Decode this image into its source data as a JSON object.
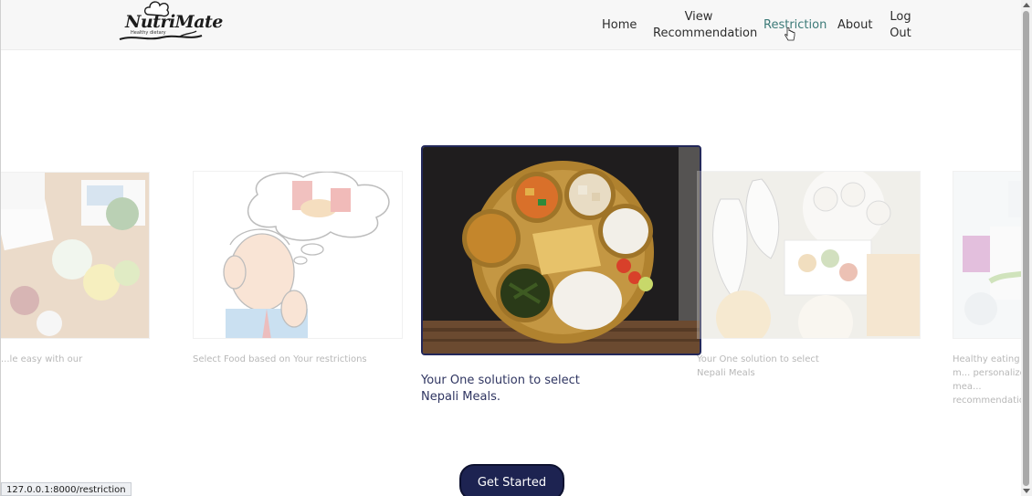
{
  "logo": {
    "text": "NutriMate",
    "subtitle": "Healthy dietary"
  },
  "nav": {
    "home": "Home",
    "view_recommendation_line1": "View",
    "view_recommendation_line2": "Recommendation",
    "restriction": "Restriction",
    "about": "About",
    "logout_line1": "Log",
    "logout_line2": "Out"
  },
  "carousel": {
    "slides": [
      {
        "caption": "...le easy with our"
      },
      {
        "caption": "Select Food based on Your restrictions"
      },
      {
        "caption": "Your One solution to select Nepali Meals."
      },
      {
        "caption": "Your One solution to select Nepali Meals"
      },
      {
        "caption": "Healthy eating m... personalized mea... recommendation..."
      }
    ],
    "active_index": 2
  },
  "cta": {
    "label": "Get Started"
  },
  "status": {
    "url": "127.0.0.1:8000/restriction"
  },
  "colors": {
    "accent": "#1d2351",
    "active_nav": "#3c7a78"
  }
}
